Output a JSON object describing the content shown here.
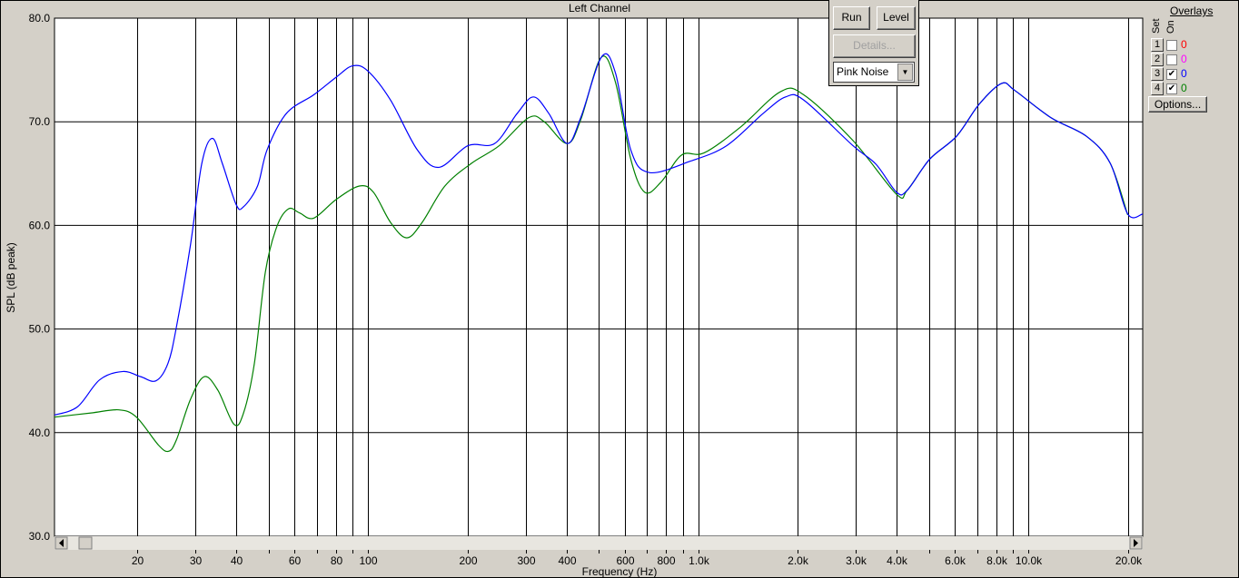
{
  "chart_data": {
    "type": "line",
    "title": "Left Channel",
    "xlabel": "Frequency (Hz)",
    "ylabel": "SPL (dB peak)",
    "xscale": "log",
    "xlim": [
      11.2,
      22200
    ],
    "ylim": [
      30,
      80
    ],
    "grid": true,
    "yticks": [
      "30.0",
      "40.0",
      "50.0",
      "60.0",
      "70.0",
      "80.0"
    ],
    "yvalues": [
      30,
      40,
      50,
      60,
      70,
      80
    ],
    "xticks": [
      {
        "v": 20,
        "l": "20"
      },
      {
        "v": 30,
        "l": "30"
      },
      {
        "v": 40,
        "l": "40"
      },
      {
        "v": 50,
        "l": ""
      },
      {
        "v": 60,
        "l": "60"
      },
      {
        "v": 70,
        "l": ""
      },
      {
        "v": 80,
        "l": "80"
      },
      {
        "v": 90,
        "l": ""
      },
      {
        "v": 100,
        "l": "100"
      },
      {
        "v": 200,
        "l": "200"
      },
      {
        "v": 300,
        "l": "300"
      },
      {
        "v": 400,
        "l": "400"
      },
      {
        "v": 500,
        "l": ""
      },
      {
        "v": 600,
        "l": "600"
      },
      {
        "v": 700,
        "l": ""
      },
      {
        "v": 800,
        "l": "800"
      },
      {
        "v": 900,
        "l": ""
      },
      {
        "v": 1000,
        "l": "1.0k"
      },
      {
        "v": 2000,
        "l": "2.0k"
      },
      {
        "v": 3000,
        "l": "3.0k"
      },
      {
        "v": 4000,
        "l": "4.0k"
      },
      {
        "v": 5000,
        "l": ""
      },
      {
        "v": 6000,
        "l": "6.0k"
      },
      {
        "v": 7000,
        "l": ""
      },
      {
        "v": 8000,
        "l": "8.0k"
      },
      {
        "v": 9000,
        "l": ""
      },
      {
        "v": 10000,
        "l": "10.0k"
      },
      {
        "v": 20000,
        "l": "20.0k"
      }
    ],
    "series": [
      {
        "name": "Set 3",
        "color": "#0000ff",
        "points": [
          [
            11.2,
            41.7
          ],
          [
            13.2,
            42.5
          ],
          [
            15.4,
            45.1
          ],
          [
            18.1,
            45.9
          ],
          [
            20.5,
            45.4
          ],
          [
            22.8,
            45.0
          ],
          [
            24.8,
            46.7
          ],
          [
            26.3,
            50.2
          ],
          [
            29,
            58.1
          ],
          [
            31.4,
            66.0
          ],
          [
            33.8,
            68.4
          ],
          [
            36.2,
            66.0
          ],
          [
            39.9,
            62.0
          ],
          [
            42,
            61.8
          ],
          [
            46.3,
            63.8
          ],
          [
            49.5,
            67.3
          ],
          [
            56.6,
            70.8
          ],
          [
            68.5,
            72.6
          ],
          [
            80.1,
            74.3
          ],
          [
            89.9,
            75.4
          ],
          [
            99.9,
            74.9
          ],
          [
            117,
            72.1
          ],
          [
            141,
            67.3
          ],
          [
            164,
            65.6
          ],
          [
            201,
            67.7
          ],
          [
            242,
            67.9
          ],
          [
            283,
            70.8
          ],
          [
            317,
            72.4
          ],
          [
            353,
            70.8
          ],
          [
            401,
            67.9
          ],
          [
            441,
            70.4
          ],
          [
            511,
            76.3
          ],
          [
            562,
            74.7
          ],
          [
            625,
            67.3
          ],
          [
            711,
            65.1
          ],
          [
            948,
            66.2
          ],
          [
            1221,
            67.7
          ],
          [
            1573,
            70.8
          ],
          [
            1841,
            72.4
          ],
          [
            2088,
            72.1
          ],
          [
            2942,
            67.7
          ],
          [
            3456,
            65.9
          ],
          [
            3990,
            63.2
          ],
          [
            4300,
            63.4
          ],
          [
            5030,
            66.4
          ],
          [
            6060,
            68.6
          ],
          [
            7100,
            71.7
          ],
          [
            8300,
            73.7
          ],
          [
            9120,
            73.0
          ],
          [
            11700,
            70.4
          ],
          [
            15000,
            68.6
          ],
          [
            17700,
            66.0
          ],
          [
            20000,
            61.1
          ],
          [
            22200,
            61.1
          ]
        ]
      },
      {
        "name": "Set 4",
        "color": "#008000",
        "points": [
          [
            11.2,
            41.5
          ],
          [
            14.5,
            41.9
          ],
          [
            17.6,
            42.2
          ],
          [
            19.9,
            41.5
          ],
          [
            23.2,
            38.8
          ],
          [
            24.9,
            38.2
          ],
          [
            26.3,
            39.3
          ],
          [
            29,
            43.2
          ],
          [
            31.9,
            45.4
          ],
          [
            35.1,
            44.1
          ],
          [
            39.3,
            40.8
          ],
          [
            42,
            41.9
          ],
          [
            45.3,
            46.7
          ],
          [
            48.9,
            55.5
          ],
          [
            53,
            59.9
          ],
          [
            57.5,
            61.6
          ],
          [
            62.1,
            61.2
          ],
          [
            68.5,
            60.7
          ],
          [
            80.1,
            62.5
          ],
          [
            94.2,
            63.8
          ],
          [
            103.9,
            63.2
          ],
          [
            117,
            60.3
          ],
          [
            131,
            58.8
          ],
          [
            146,
            60.3
          ],
          [
            171,
            63.8
          ],
          [
            206,
            66.0
          ],
          [
            250,
            67.7
          ],
          [
            307,
            70.4
          ],
          [
            342,
            70.0
          ],
          [
            401,
            67.9
          ],
          [
            441,
            70.2
          ],
          [
            508,
            76.2
          ],
          [
            562,
            73.8
          ],
          [
            625,
            66.4
          ],
          [
            689,
            63.2
          ],
          [
            773,
            64.2
          ],
          [
            892,
            66.8
          ],
          [
            1043,
            67.0
          ],
          [
            1345,
            69.5
          ],
          [
            1776,
            72.9
          ],
          [
            2088,
            72.6
          ],
          [
            2942,
            68.2
          ],
          [
            3990,
            63.0
          ],
          [
            4300,
            63.4
          ],
          [
            5030,
            66.4
          ],
          [
            6060,
            68.6
          ],
          [
            7100,
            71.7
          ],
          [
            8300,
            73.7
          ],
          [
            9120,
            73.0
          ],
          [
            11700,
            70.4
          ],
          [
            15000,
            68.6
          ],
          [
            17700,
            66.0
          ],
          [
            20000,
            61.0
          ]
        ]
      }
    ]
  },
  "controls": {
    "run": "Run",
    "level": "Level",
    "details": "Details...",
    "source": "Pink Noise"
  },
  "overlays": {
    "title": "Overlays",
    "set_label": "Set",
    "on_label": "On",
    "options": "Options...",
    "items": [
      {
        "set": "1",
        "on": false,
        "value": "0",
        "color": "#ff0000"
      },
      {
        "set": "2",
        "on": false,
        "value": "0",
        "color": "#ff00ff"
      },
      {
        "set": "3",
        "on": true,
        "value": "0",
        "color": "#0000ff"
      },
      {
        "set": "4",
        "on": true,
        "value": "0",
        "color": "#008000"
      }
    ]
  }
}
